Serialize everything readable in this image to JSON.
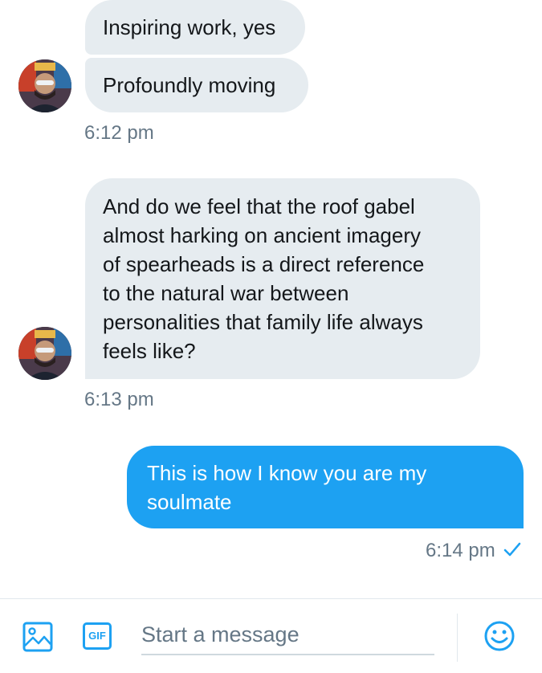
{
  "messages": [
    {
      "text": "Inspiring work, yes",
      "direction": "in"
    },
    {
      "text": "Profoundly moving",
      "direction": "in"
    },
    {
      "timestamp": "6:12 pm"
    },
    {
      "lines": [
        "And do we feel that the roof gabel",
        "almost harking on ancient imagery",
        "of spearheads is a direct reference",
        "to the natural war between",
        "personalities that family life always",
        "feels like?"
      ],
      "direction": "in"
    },
    {
      "timestamp": "6:13 pm"
    },
    {
      "lines": [
        "This is how I know you are my",
        "soulmate"
      ],
      "direction": "out"
    },
    {
      "timestamp": "6:14 pm",
      "read_icon": "check-icon"
    }
  ],
  "composer": {
    "placeholder": "Start a message",
    "gif_label": "GIF",
    "media_icon": "image-icon",
    "emoji_icon": "emoji-icon"
  },
  "colors": {
    "incoming_bubble": "#e6ecf0",
    "outgoing_bubble": "#1da1f2",
    "accent": "#1da1f2",
    "timestamp": "#657786"
  }
}
